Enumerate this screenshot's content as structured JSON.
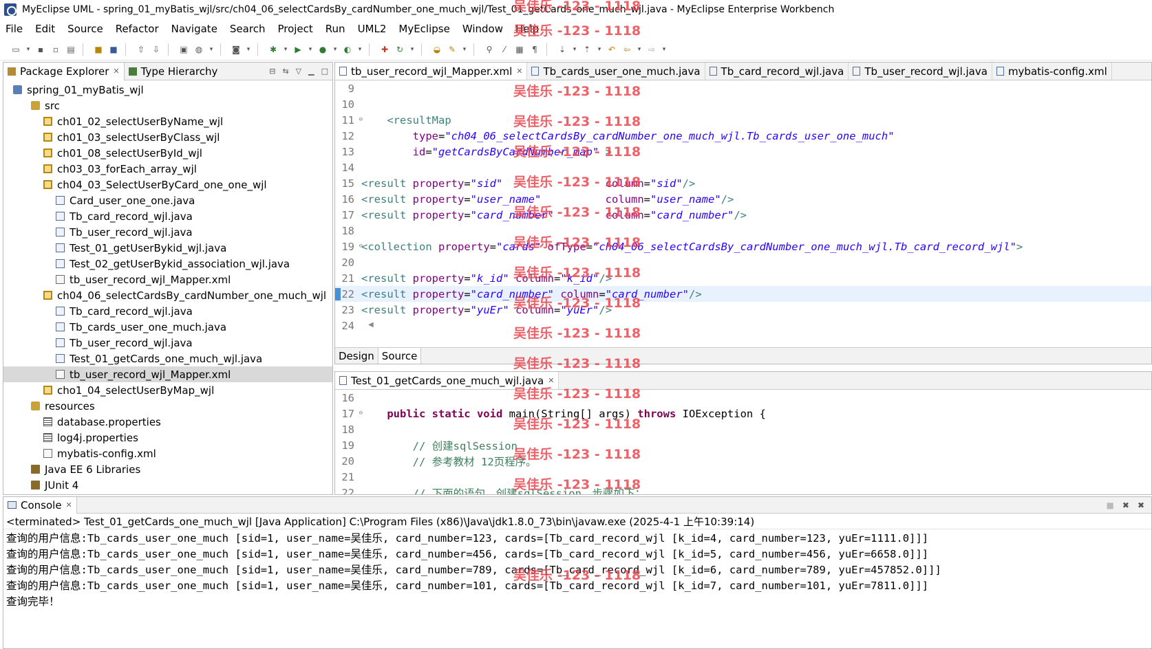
{
  "window": {
    "title": "MyEclipse UML - spring_01_myBatis_wjl/src/ch04_06_selectCardsBy_cardNumber_one_much_wjl/Test_01_getCards_one_much_wjl.java - MyEclipse Enterprise Workbench"
  },
  "menu": [
    "File",
    "Edit",
    "Source",
    "Refactor",
    "Navigate",
    "Search",
    "Project",
    "Run",
    "UML2",
    "MyEclipse",
    "Window",
    "Help"
  ],
  "package_explorer": {
    "tab_label": "Package Explorer",
    "tab2_label": "Type Hierarchy",
    "tree": [
      {
        "label": "spring_01_myBatis_wjl",
        "depth": 0,
        "icon": "project-icon",
        "kind": "proj"
      },
      {
        "label": "src",
        "depth": 1,
        "icon": "source-folder-icon",
        "kind": "srcf"
      },
      {
        "label": "ch01_02_selectUserByName_wjl",
        "depth": 2,
        "icon": "package-icon",
        "kind": "pkg"
      },
      {
        "label": "ch01_03_selectUserByClass_wjl",
        "depth": 2,
        "icon": "package-icon",
        "kind": "pkg"
      },
      {
        "label": "ch01_08_selectUserById_wjl",
        "depth": 2,
        "icon": "package-icon",
        "kind": "pkg"
      },
      {
        "label": "ch03_03_forEach_array_wjl",
        "depth": 2,
        "icon": "package-icon",
        "kind": "pkg"
      },
      {
        "label": "ch04_03_SelectUserByCard_one_one_wjl",
        "depth": 2,
        "icon": "package-icon",
        "kind": "pkg"
      },
      {
        "label": "Card_user_one_one.java",
        "depth": 3,
        "icon": "java-file-icon",
        "kind": "java"
      },
      {
        "label": "Tb_card_record_wjl.java",
        "depth": 3,
        "icon": "java-file-icon",
        "kind": "java"
      },
      {
        "label": "Tb_user_record_wjl.java",
        "depth": 3,
        "icon": "java-file-icon",
        "kind": "java"
      },
      {
        "label": "Test_01_getUserBykid_wjl.java",
        "depth": 3,
        "icon": "java-file-icon",
        "kind": "java"
      },
      {
        "label": "Test_02_getUserBykid_association_wjl.java",
        "depth": 3,
        "icon": "java-file-icon",
        "kind": "java"
      },
      {
        "label": "tb_user_record_wjl_Mapper.xml",
        "depth": 3,
        "icon": "xml-file-icon",
        "kind": "xml"
      },
      {
        "label": "ch04_06_selectCardsBy_cardNumber_one_much_wjl",
        "depth": 2,
        "icon": "package-icon",
        "kind": "pkg"
      },
      {
        "label": "Tb_card_record_wjl.java",
        "depth": 3,
        "icon": "java-file-icon",
        "kind": "java"
      },
      {
        "label": "Tb_cards_user_one_much.java",
        "depth": 3,
        "icon": "java-file-icon",
        "kind": "java"
      },
      {
        "label": "Tb_user_record_wjl.java",
        "depth": 3,
        "icon": "java-file-icon",
        "kind": "java"
      },
      {
        "label": "Test_01_getCards_one_much_wjl.java",
        "depth": 3,
        "icon": "java-file-icon",
        "kind": "java"
      },
      {
        "label": "tb_user_record_wjl_Mapper.xml",
        "depth": 3,
        "icon": "xml-file-icon",
        "kind": "xml",
        "selected": true
      },
      {
        "label": "cho1_04_selectUserByMap_wjl",
        "depth": 2,
        "icon": "package-icon",
        "kind": "pkg"
      },
      {
        "label": "resources",
        "depth": 1,
        "icon": "source-folder-icon",
        "kind": "srcf"
      },
      {
        "label": "database.properties",
        "depth": 2,
        "icon": "properties-file-icon",
        "kind": "props"
      },
      {
        "label": "log4j.properties",
        "depth": 2,
        "icon": "properties-file-icon",
        "kind": "props"
      },
      {
        "label": "mybatis-config.xml",
        "depth": 2,
        "icon": "xml-file-icon",
        "kind": "xml"
      },
      {
        "label": "Java EE 6 Libraries",
        "depth": 1,
        "icon": "library-icon",
        "kind": "lib"
      },
      {
        "label": "JUnit 4",
        "depth": 1,
        "icon": "library-icon",
        "kind": "lib"
      }
    ]
  },
  "editor_tabs": [
    {
      "label": "tb_user_record_wjl_Mapper.xml",
      "active": true
    },
    {
      "label": "Tb_cards_user_one_much.java"
    },
    {
      "label": "Tb_card_record_wjl.java"
    },
    {
      "label": "Tb_user_record_wjl.java"
    },
    {
      "label": "mybatis-config.xml"
    }
  ],
  "xml_editor": {
    "lines": [
      {
        "n": "9",
        "parts": []
      },
      {
        "n": "10",
        "parts": []
      },
      {
        "n": "11",
        "fold": true,
        "parts": [
          [
            "pl",
            "    "
          ],
          [
            "tag",
            "<resultMap"
          ]
        ]
      },
      {
        "n": "12",
        "parts": [
          [
            "pl",
            "        "
          ],
          [
            "attr",
            "type"
          ],
          [
            "pl",
            "="
          ],
          [
            "val",
            "\"ch04_06_selectCardsBy_cardNumber_one_much_wjl.Tb_cards_user_one_much\""
          ]
        ]
      },
      {
        "n": "13",
        "parts": [
          [
            "pl",
            "        "
          ],
          [
            "attr",
            "id"
          ],
          [
            "pl",
            "="
          ],
          [
            "val",
            "\"getCardsByCardNumber_map\""
          ],
          [
            "pl",
            " "
          ],
          [
            "tag",
            ">"
          ]
        ]
      },
      {
        "n": "14",
        "parts": []
      },
      {
        "n": "15",
        "parts": [
          [
            "tag",
            "<result"
          ],
          [
            "pl",
            " "
          ],
          [
            "attr",
            "property"
          ],
          [
            "pl",
            "="
          ],
          [
            "val",
            "\"sid\""
          ],
          [
            "pl",
            "                "
          ],
          [
            "attr",
            "column"
          ],
          [
            "pl",
            "="
          ],
          [
            "val",
            "\"sid\""
          ],
          [
            "tag",
            "/>"
          ]
        ]
      },
      {
        "n": "16",
        "parts": [
          [
            "tag",
            "<result"
          ],
          [
            "pl",
            " "
          ],
          [
            "attr",
            "property"
          ],
          [
            "pl",
            "="
          ],
          [
            "val",
            "\"user_name\""
          ],
          [
            "pl",
            "          "
          ],
          [
            "attr",
            "column"
          ],
          [
            "pl",
            "="
          ],
          [
            "val",
            "\"user_name\""
          ],
          [
            "tag",
            "/>"
          ]
        ]
      },
      {
        "n": "17",
        "parts": [
          [
            "tag",
            "<result"
          ],
          [
            "pl",
            " "
          ],
          [
            "attr",
            "property"
          ],
          [
            "pl",
            "="
          ],
          [
            "val",
            "\"card_number\""
          ],
          [
            "pl",
            "        "
          ],
          [
            "attr",
            "column"
          ],
          [
            "pl",
            "="
          ],
          [
            "val",
            "\"card_number\""
          ],
          [
            "tag",
            "/>"
          ]
        ]
      },
      {
        "n": "18",
        "parts": []
      },
      {
        "n": "19",
        "fold": true,
        "parts": [
          [
            "tag",
            "<collection"
          ],
          [
            "pl",
            " "
          ],
          [
            "attr",
            "property"
          ],
          [
            "pl",
            "="
          ],
          [
            "val",
            "\"cards\""
          ],
          [
            "pl",
            " "
          ],
          [
            "attr",
            "ofType"
          ],
          [
            "pl",
            "="
          ],
          [
            "val",
            "\"ch04_06_selectCardsBy_cardNumber_one_much_wjl.Tb_card_record_wjl\""
          ],
          [
            "tag",
            ">"
          ]
        ]
      },
      {
        "n": "20",
        "parts": []
      },
      {
        "n": "21",
        "parts": [
          [
            "tag",
            "<result"
          ],
          [
            "pl",
            " "
          ],
          [
            "attr",
            "property"
          ],
          [
            "pl",
            "="
          ],
          [
            "val",
            "\"k_id\""
          ],
          [
            "pl",
            " "
          ],
          [
            "attr",
            "column"
          ],
          [
            "pl",
            "="
          ],
          [
            "val",
            "\"k_id\""
          ],
          [
            "tag",
            "/>"
          ]
        ]
      },
      {
        "n": "22",
        "hl": true,
        "parts": [
          [
            "tag",
            "<result"
          ],
          [
            "pl",
            " "
          ],
          [
            "attr",
            "property"
          ],
          [
            "pl",
            "="
          ],
          [
            "val",
            "\"card_number\""
          ],
          [
            "pl",
            " "
          ],
          [
            "attr",
            "column"
          ],
          [
            "pl",
            "="
          ],
          [
            "val",
            "\"card_number\""
          ],
          [
            "tag",
            "/>"
          ]
        ]
      },
      {
        "n": "23",
        "parts": [
          [
            "tag",
            "<result"
          ],
          [
            "pl",
            " "
          ],
          [
            "attr",
            "property"
          ],
          [
            "pl",
            "="
          ],
          [
            "val",
            "\"yuEr\""
          ],
          [
            "pl",
            " "
          ],
          [
            "attr",
            "column"
          ],
          [
            "pl",
            "="
          ],
          [
            "val",
            "\"yuEr\""
          ],
          [
            "tag",
            "/>"
          ]
        ]
      },
      {
        "n": "24",
        "parts": []
      }
    ],
    "design_tab": "Design",
    "source_tab": "Source"
  },
  "java_editor": {
    "tab_label": "Test_01_getCards_one_much_wjl.java",
    "lines": [
      {
        "n": "16",
        "parts": []
      },
      {
        "n": "17",
        "fold": true,
        "parts": [
          [
            "pl",
            "    "
          ],
          [
            "kw",
            "public static void"
          ],
          [
            "pl",
            " main(String[] args) "
          ],
          [
            "kw",
            "throws"
          ],
          [
            "pl",
            " IOException {"
          ]
        ]
      },
      {
        "n": "18",
        "parts": []
      },
      {
        "n": "19",
        "parts": [
          [
            "pl",
            "        "
          ],
          [
            "com",
            "// 创建sqlSession"
          ]
        ]
      },
      {
        "n": "20",
        "parts": [
          [
            "pl",
            "        "
          ],
          [
            "com",
            "// 参考教材 12页程序。"
          ]
        ]
      },
      {
        "n": "21",
        "parts": []
      },
      {
        "n": "22",
        "parts": [
          [
            "pl",
            "        "
          ],
          [
            "com",
            "// 下面的语句，创建sqlSession，步骤如下："
          ]
        ]
      }
    ]
  },
  "console": {
    "tab_label": "Console",
    "status": "<terminated> Test_01_getCards_one_much_wjl [Java Application] C:\\Program Files (x86)\\Java\\jdk1.8.0_73\\bin\\javaw.exe (2025-4-1 上午10:39:14)",
    "output": [
      "查询的用户信息:Tb_cards_user_one_much [sid=1, user_name=吴佳乐, card_number=123, cards=[Tb_card_record_wjl [k_id=4, card_number=123, yuEr=1111.0]]]",
      "查询的用户信息:Tb_cards_user_one_much [sid=1, user_name=吴佳乐, card_number=456, cards=[Tb_card_record_wjl [k_id=5, card_number=456, yuEr=6658.0]]]",
      "查询的用户信息:Tb_cards_user_one_much [sid=1, user_name=吴佳乐, card_number=789, cards=[Tb_card_record_wjl [k_id=6, card_number=789, yuEr=457852.0]]]",
      "查询的用户信息:Tb_cards_user_one_much [sid=1, user_name=吴佳乐, card_number=101, cards=[Tb_card_record_wjl [k_id=7, card_number=101, yuEr=7811.0]]]",
      "查询完毕！"
    ]
  },
  "watermark": {
    "text": "吴佳乐 -123 - 1118",
    "color": "#e8474f"
  }
}
